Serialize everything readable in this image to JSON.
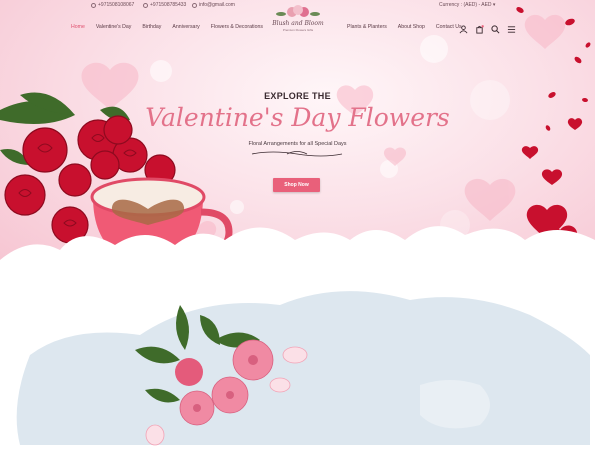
{
  "topbar": {
    "phone1": "+971508108067",
    "phone2": "+971508785433",
    "email": "info@gmail.com",
    "currency_label": "Currency : (AED) - AED"
  },
  "logo": {
    "name": "Blush and Bloom",
    "tagline": "Premium Flowers Gifts"
  },
  "nav": {
    "left": [
      {
        "label": "Home",
        "active": true
      },
      {
        "label": "Valentine's Day"
      },
      {
        "label": "Birthday"
      },
      {
        "label": "Anniversary"
      },
      {
        "label": "Flowers & Decorations"
      }
    ],
    "right": [
      {
        "label": "Plants & Planters"
      },
      {
        "label": "About Shop"
      },
      {
        "label": "Contact Us"
      }
    ]
  },
  "header_icons": [
    "user-icon",
    "cart-icon",
    "search-icon",
    "menu-icon"
  ],
  "hero": {
    "eyebrow": "EXPLORE THE",
    "title": "Valentine's Day Flowers",
    "subtitle": "Floral Arrangements for all Special Days",
    "cta_label": "Shop Now"
  },
  "colors": {
    "accent": "#e9607a",
    "title": "#e3728a",
    "hero_bg": "#f8d3dc",
    "rose": "#c8102e",
    "map": "#dde7ef"
  }
}
